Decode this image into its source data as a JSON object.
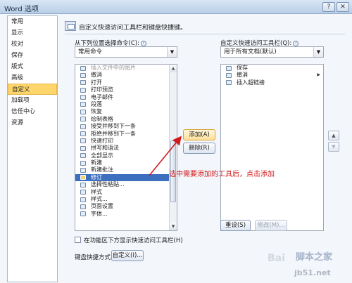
{
  "window": {
    "title": "Word 选项",
    "controls": [
      "?",
      "✕"
    ]
  },
  "nav": {
    "items": [
      {
        "label": "常用",
        "selected": false
      },
      {
        "label": "显示",
        "selected": false
      },
      {
        "label": "校对",
        "selected": false
      },
      {
        "label": "保存",
        "selected": false
      },
      {
        "label": "版式",
        "selected": false
      },
      {
        "label": "高级",
        "selected": false
      },
      {
        "label": "自定义",
        "selected": true
      },
      {
        "label": "加载项",
        "selected": false
      },
      {
        "label": "信任中心",
        "selected": false
      },
      {
        "label": "资源",
        "selected": false
      }
    ]
  },
  "header": {
    "text": "自定义快速访问工具栏和键盘快捷键。"
  },
  "left_panel": {
    "label": "从下列位置选择命令(C):",
    "dropdown_value": "常用命令",
    "commands": [
      {
        "label": "插入文件中的图片",
        "icon": "picture-icon"
      },
      {
        "label": "撤消",
        "icon": "undo-icon",
        "submenu": true
      },
      {
        "label": "打开",
        "icon": "open-folder-icon"
      },
      {
        "label": "打印预览",
        "icon": "print-preview-icon"
      },
      {
        "label": "电子邮件",
        "icon": "email-icon"
      },
      {
        "label": "段落",
        "icon": "paragraph-icon"
      },
      {
        "label": "恢复",
        "icon": "redo-icon"
      },
      {
        "label": "绘制表格",
        "icon": "draw-table-icon"
      },
      {
        "label": "接受并移到下一条",
        "icon": "accept-change-icon"
      },
      {
        "label": "拒绝并移到下一条",
        "icon": "reject-change-icon"
      },
      {
        "label": "快速打印",
        "icon": "quick-print-icon"
      },
      {
        "label": "拼写和语法",
        "icon": "spelling-icon"
      },
      {
        "label": "全部显示",
        "icon": "show-all-icon"
      },
      {
        "label": "新建",
        "icon": "new-document-icon"
      },
      {
        "label": "新建批注",
        "icon": "new-comment-icon"
      },
      {
        "label": "修订",
        "icon": "track-changes-icon",
        "selected": true
      },
      {
        "label": "选择性粘贴...",
        "icon": "paste-special-icon"
      },
      {
        "label": "样式",
        "icon": "style-icon",
        "marker": "I▾"
      },
      {
        "label": "样式...",
        "icon": "styles-icon"
      },
      {
        "label": "页面设置",
        "icon": "page-setup-icon"
      },
      {
        "label": "字体...",
        "icon": "font-icon"
      }
    ]
  },
  "right_panel": {
    "label": "自定义快速访问工具栏(Q):",
    "dropdown_value": "用于所有文档(默认)",
    "items": [
      {
        "label": "保存",
        "icon": "save-icon"
      },
      {
        "label": "撤消",
        "icon": "undo-icon",
        "submenu": true
      },
      {
        "label": "插入超链接",
        "icon": "hyperlink-icon"
      }
    ]
  },
  "buttons": {
    "add": "添加(A) >>",
    "remove": "删除(R)",
    "reset": "重设(S)",
    "modify": "修改(M)...",
    "customize": "自定义(I)...",
    "move_up": "▲",
    "move_down": "▼"
  },
  "bottom": {
    "checkbox_label": "在功能区下方显示快速访问工具栏(H)",
    "shortcut_label": "键盘快捷方式:"
  },
  "annotation": {
    "text": "选中需要添加的工具后，点击添加",
    "color": "#d11a1a"
  },
  "watermarks": {
    "site1": "脚本之家",
    "site2": "jb51.net",
    "baidu": "Bai"
  }
}
